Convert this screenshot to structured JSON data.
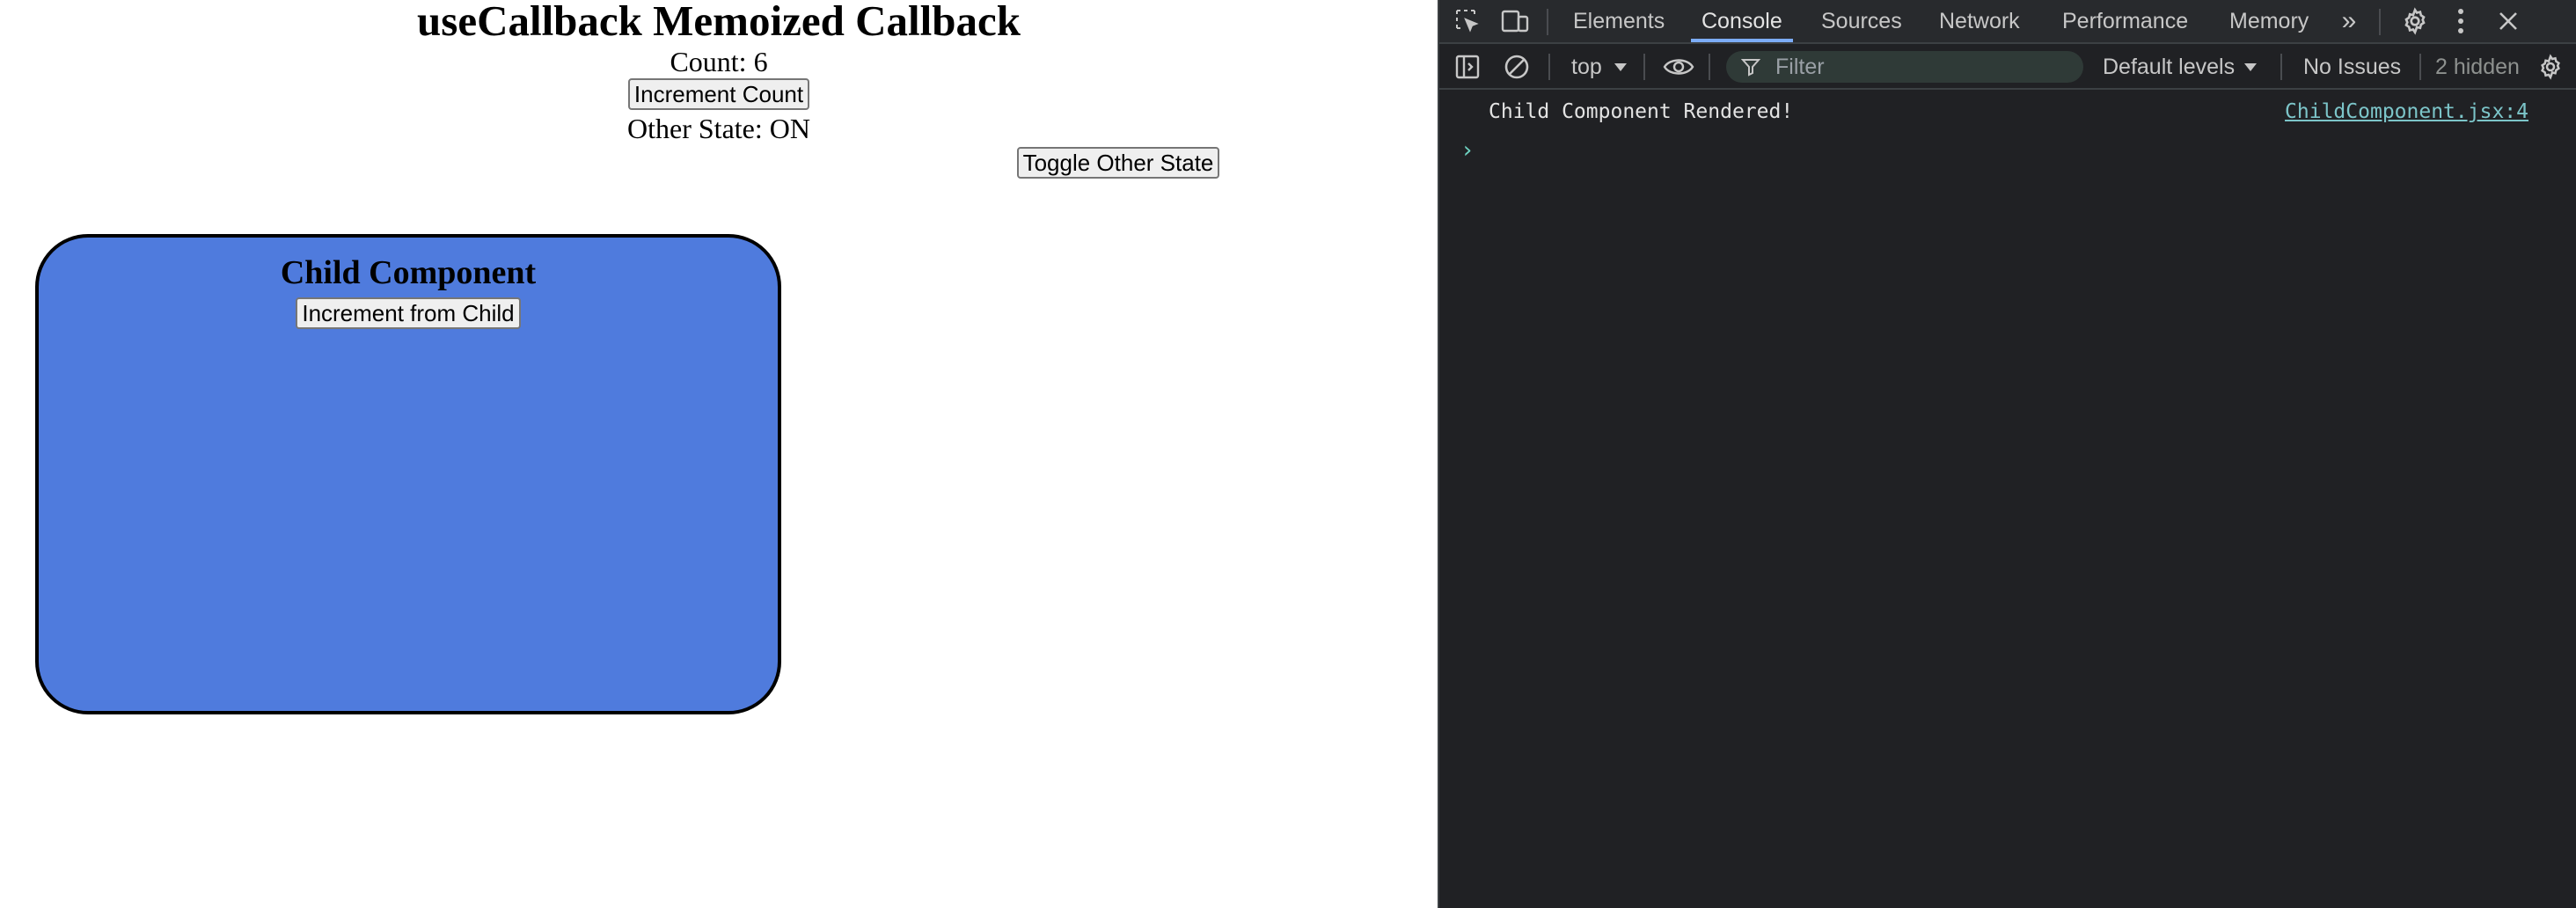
{
  "app": {
    "title": "useCallback Memoized Callback",
    "count_text": "Count: 6",
    "increment_button": "Increment Count",
    "other_state_text": "Other State: ON",
    "toggle_button": "Toggle Other State",
    "child": {
      "title": "Child Component",
      "button": "Increment from Child",
      "background_color": "#4f7bdd"
    }
  },
  "devtools": {
    "tabs": [
      {
        "label": "Elements"
      },
      {
        "label": "Console",
        "active": true
      },
      {
        "label": "Sources"
      },
      {
        "label": "Network"
      },
      {
        "label": "Performance"
      },
      {
        "label": "Memory"
      }
    ],
    "more_tabs_icon": "double-chevron-right-icon",
    "toolbar": {
      "context": "top",
      "filter_placeholder": "Filter",
      "levels": "Default levels",
      "issues": "No Issues",
      "hidden": "2 hidden"
    },
    "console": {
      "messages": [
        {
          "text": "Child Component Rendered!",
          "source": "ChildComponent.jsx:4"
        }
      ],
      "prompt": "›"
    },
    "accent_color": "#7cacf8"
  }
}
